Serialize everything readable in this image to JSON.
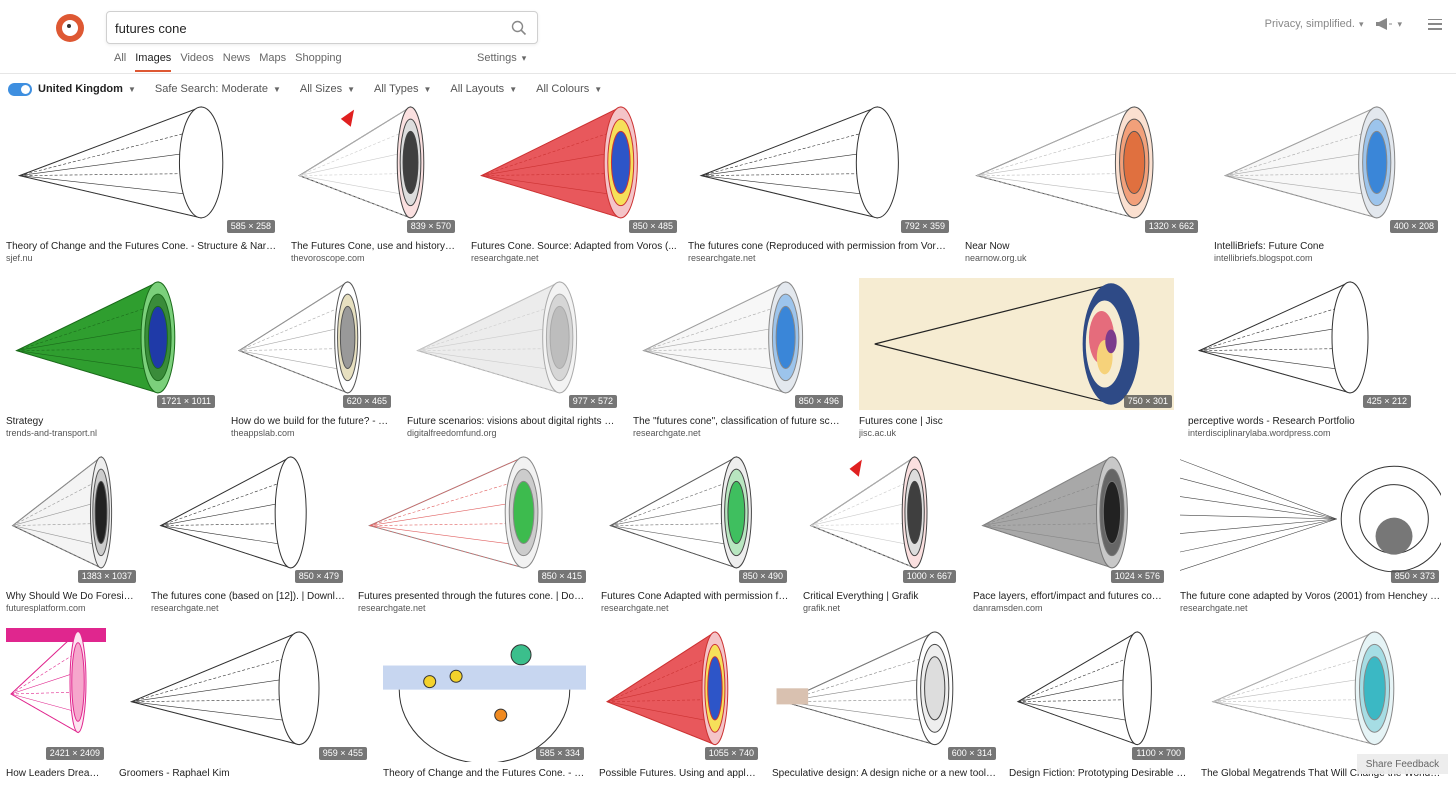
{
  "search": {
    "query": "futures cone"
  },
  "header": {
    "privacy_label": "Privacy, simplified."
  },
  "nav": {
    "tabs": [
      "All",
      "Images",
      "Videos",
      "News",
      "Maps",
      "Shopping"
    ],
    "settings_label": "Settings"
  },
  "filters": {
    "region": "United Kingdom",
    "safe_search": "Safe Search: Moderate",
    "sizes": "All Sizes",
    "types": "All Types",
    "layouts": "All Layouts",
    "colours": "All Colours"
  },
  "colors": {
    "accent": "#de5833",
    "toggle": "#3e8fe0"
  },
  "results": [
    {
      "title": "Theory of Change and the Futures Cone. - Structure & Narrati...",
      "source": "sjef.nu",
      "dims": "585 × 258",
      "style": "cone"
    },
    {
      "title": "The Futures Cone, use and history - ...",
      "source": "thevoroscope.com",
      "dims": "839 × 570",
      "style": "preposterous"
    },
    {
      "title": "Futures Cone. Source: Adapted from Voros (...",
      "source": "researchgate.net",
      "dims": "850 × 485",
      "style": "redcone"
    },
    {
      "title": "The futures cone (Reproduced with permission from Voros ...",
      "source": "researchgate.net",
      "dims": "792 × 359",
      "style": "cone"
    },
    {
      "title": "Near Now",
      "source": "nearnow.org.uk",
      "dims": "1320 × 662",
      "style": "orange"
    },
    {
      "title": "IntelliBriefs: Future Cone",
      "source": "intellibriefs.blogspot.com",
      "dims": "400 × 208",
      "style": "bluecone"
    },
    {
      "title": "Strategy",
      "source": "trends-and-transport.nl",
      "dims": "1721 × 1011",
      "style": "green"
    },
    {
      "title": "How do we build for the future? - Th...",
      "source": "theappslab.com",
      "dims": "620 × 465",
      "style": "types"
    },
    {
      "title": "Future scenarios: visions about digital rights be...",
      "source": "digitalfreedomfund.org",
      "dims": "977 × 572",
      "style": "gray"
    },
    {
      "title": "The \"futures cone\", classification of future scen...",
      "source": "researchgate.net",
      "dims": "850 × 496",
      "style": "bluecone"
    },
    {
      "title": "Futures cone | Jisc",
      "source": "jisc.ac.uk",
      "dims": "750 × 301",
      "style": "jisc"
    },
    {
      "title": "perceptive words - Research Portfolio",
      "source": "interdisciplinarylaba.wordpress.com",
      "dims": "425 × 212",
      "style": "cone"
    },
    {
      "title": "Why Should We Do Foresight?",
      "source": "futuresplatform.com",
      "dims": "1383 × 1037",
      "style": "small"
    },
    {
      "title": "The futures cone (based on [12]). | Downloa...",
      "source": "researchgate.net",
      "dims": "850 × 479",
      "style": "cone"
    },
    {
      "title": "Futures presented through the futures cone. | Dow...",
      "source": "researchgate.net",
      "dims": "850 × 415",
      "style": "business"
    },
    {
      "title": "Futures Cone Adapted with permission fr...",
      "source": "researchgate.net",
      "dims": "850 × 490",
      "style": "greencone"
    },
    {
      "title": "Critical Everything | Grafik",
      "source": "grafik.net",
      "dims": "1000 × 667",
      "style": "preposterous"
    },
    {
      "title": "Pace layers, effort/impact and futures cone...",
      "source": "danramsden.com",
      "dims": "1024 × 576",
      "style": "darkgray"
    },
    {
      "title": "The future cone adapted by Voros (2001) from Henchey (1...",
      "source": "researchgate.net",
      "dims": "850 × 373",
      "style": "henchey"
    },
    {
      "title": "How Leaders Dream ...",
      "source": "",
      "dims": "2421 × 2409",
      "style": "pink"
    },
    {
      "title": "Groomers - Raphael Kim",
      "source": "",
      "dims": "959 × 455",
      "style": "cone"
    },
    {
      "title": "Theory of Change and the Futures Cone. - St...",
      "source": "",
      "dims": "585 × 334",
      "style": "swans"
    },
    {
      "title": "Possible Futures. Using and applyi...",
      "source": "",
      "dims": "1055 × 740",
      "style": "redcone"
    },
    {
      "title": "Speculative design: A design niche or a new tool f...",
      "source": "",
      "dims": "600 × 314",
      "style": "torch"
    },
    {
      "title": "Design Fiction: Prototyping Desirable F...",
      "source": "",
      "dims": "1100 × 700",
      "style": "cone"
    },
    {
      "title": "The Global Megatrends That Will Change the World in ...",
      "source": "",
      "dims": "",
      "style": "teal"
    }
  ]
}
